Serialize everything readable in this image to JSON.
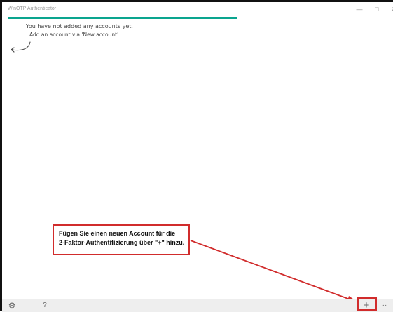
{
  "window": {
    "title": "WinOTP Authenticator",
    "controls": {
      "minimize": "—",
      "maximize": "□",
      "close": "✕"
    }
  },
  "progress": {
    "value": 0.6
  },
  "empty_state": {
    "line1": "You have not added any accounts yet.",
    "line2": "Add an account via 'New account'."
  },
  "callout": {
    "line1": "Fügen Sie einen neuen Account für die",
    "line2": "2-Faktor-Authentifizierung über \"+\" hinzu."
  },
  "app_bar": {
    "settings_icon": "⚙",
    "help_label": "?",
    "add_label": "+",
    "more_label": "··"
  },
  "colors": {
    "accent": "#0aa58f",
    "annotation": "#d12c2c"
  }
}
